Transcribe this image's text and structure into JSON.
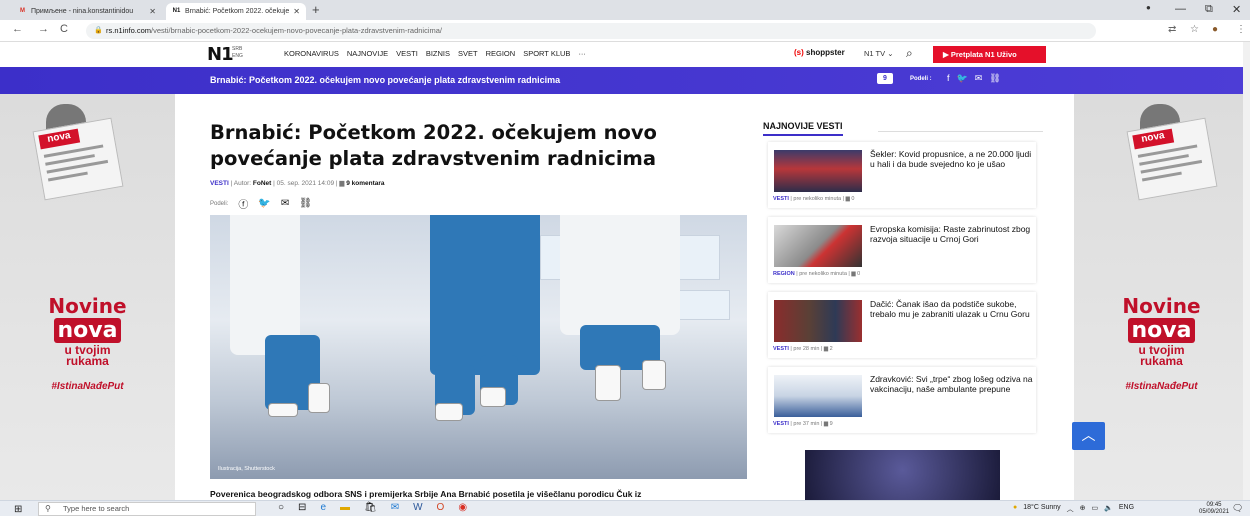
{
  "browser": {
    "tabs": [
      {
        "favicon": "M",
        "title": "Примљене - nina.konstantinidou",
        "close": "✕"
      },
      {
        "favicon": "N1",
        "title": "Brnabić: Početkom 2022. očekuje",
        "close": "✕"
      }
    ],
    "new_tab": "+",
    "window_controls": [
      "—",
      "⧉",
      "✕"
    ],
    "nav": {
      "back": "←",
      "forward": "→",
      "reload": "C"
    },
    "url_host": "rs.n1info.com",
    "url_path": "/vesti/brnabic-pocetkom-2022-ocekujem-novo-povecanje-plata-zdravstvenim-radnicima/",
    "toolbar_icons": [
      "translate-icon",
      "star-icon",
      "profile-icon",
      "menu-icon"
    ]
  },
  "site": {
    "logo": "N1",
    "lang_top": "SRB",
    "lang_bottom": "ENG",
    "nav": [
      "KORONAVIRUS",
      "NAJNOVIJE",
      "VESTI",
      "BIZNIS",
      "SVET",
      "REGION",
      "SPORT KLUB",
      "···"
    ],
    "shoppster_logo": "(s)",
    "shoppster": "shoppster",
    "n1tv": "N1 TV ⌄",
    "subscribe": "▶ Pretplata N1 Uživo"
  },
  "sticky": {
    "title": "Brnabić: Početkom 2022. očekujem novo povećanje plata zdravstvenim radnicima",
    "comment_count": "9",
    "share_label": "Podeli :"
  },
  "article": {
    "title": "Brnabić: Početkom 2022. očekujem novo povećanje plata zdravstvenim radnicima",
    "category": "VESTI",
    "meta_mid": " | Autor: ",
    "author": "FoNet",
    "meta_end": " | 05. sep. 2021 14:09 | ",
    "comments": "9 komentara",
    "share_label": "Podeli:",
    "image_credit": "Ilustracija, Shutterstock",
    "lead": "Poverenica beogradskog odbora SNS i premijerka Srbije Ana Brnabić posetila je višečlanu porodicu Čuk iz"
  },
  "sidebar": {
    "heading": "NAJNOVIJE VESTI",
    "items": [
      {
        "title": "Šekler: Kovid propusnice, a ne 20.000 ljudi u hali i da bude svejedno ko je ušao",
        "category": "VESTI",
        "time": " | pre nekoliko minuta | ",
        "comments": "0"
      },
      {
        "title": "Evropska komisija: Raste zabrinutost zbog razvoja situacije u Crnoj Gori",
        "category": "REGION",
        "time": " | pre nekoliko minuta | ",
        "comments": "0"
      },
      {
        "title": "Dačić: Čanak išao da podstiče sukobe, trebalo mu je zabraniti ulazak u Crnu Goru",
        "category": "VESTI",
        "time": " | pre 28 min | ",
        "comments": "2"
      },
      {
        "title": "Zdravković: Svi „trpe“ zbog lošeg odziva na vakcinaciju, naše ambulante prepune",
        "category": "VESTI",
        "time": " | pre 37 min | ",
        "comments": "9"
      }
    ]
  },
  "ad": {
    "novine": "Novine",
    "nova": "nova",
    "sub1": "u tvojim",
    "sub2": "rukama",
    "tag": "#IstinaNađePut"
  },
  "taskbar": {
    "search_placeholder": "Type here to search",
    "weather": "18°C  Sunny",
    "lang": "ENG",
    "time": "09:45",
    "date": "05/09/2021"
  }
}
